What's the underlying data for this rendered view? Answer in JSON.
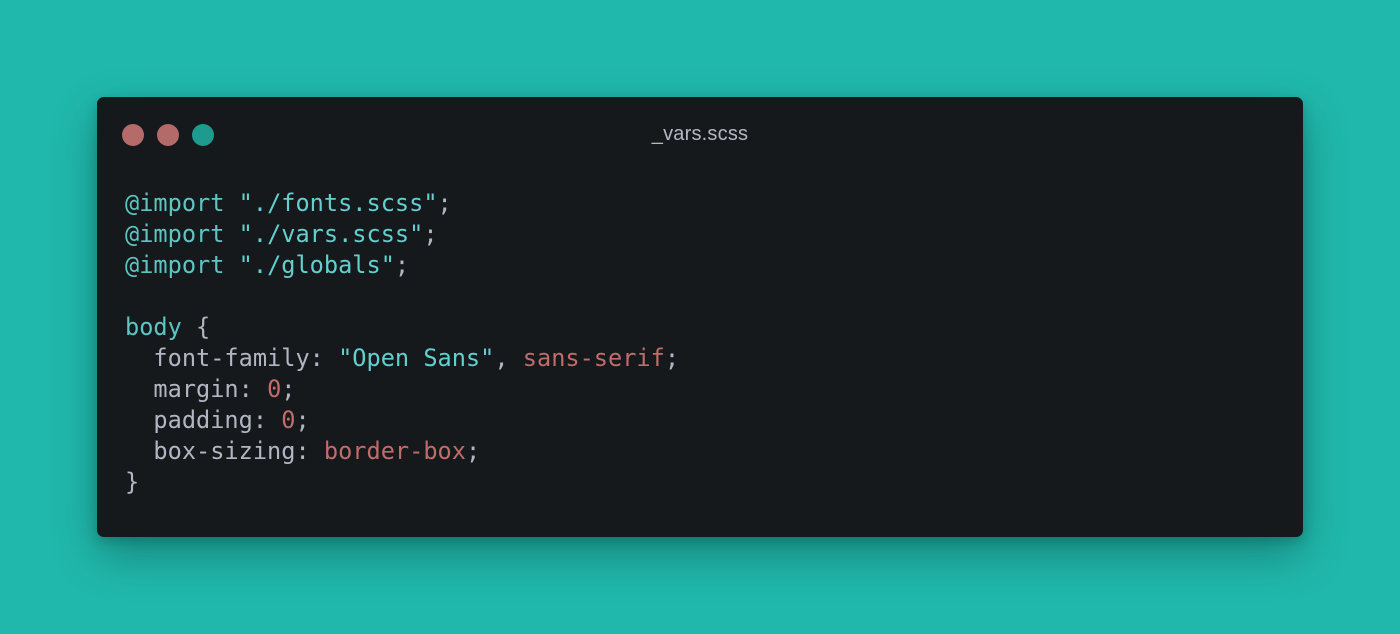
{
  "window": {
    "title": "_vars.scss",
    "controls": [
      {
        "name": "close",
        "color": "#b56b6a"
      },
      {
        "name": "minimize",
        "color": "#b36b6a"
      },
      {
        "name": "zoom",
        "color": "#1e9a8e"
      }
    ]
  },
  "colors": {
    "background": "#20b8ac",
    "editor": "#15191c",
    "at_rule": "#5ec5c3",
    "string": "#62d0ce",
    "keyword": "#c26b6b",
    "text": "#b2b6c3"
  },
  "code": {
    "lines": [
      [
        {
          "t": "@import",
          "k": "at"
        },
        {
          "t": " ",
          "k": "punc"
        },
        {
          "t": "\"./fonts.scss\"",
          "k": "str"
        },
        {
          "t": ";",
          "k": "punc"
        }
      ],
      [
        {
          "t": "@import",
          "k": "at"
        },
        {
          "t": " ",
          "k": "punc"
        },
        {
          "t": "\"./vars.scss\"",
          "k": "str"
        },
        {
          "t": ";",
          "k": "punc"
        }
      ],
      [
        {
          "t": "@import",
          "k": "at"
        },
        {
          "t": " ",
          "k": "punc"
        },
        {
          "t": "\"./globals\"",
          "k": "str"
        },
        {
          "t": ";",
          "k": "punc"
        }
      ],
      [],
      [
        {
          "t": "body",
          "k": "sel"
        },
        {
          "t": " {",
          "k": "punc"
        }
      ],
      [
        {
          "t": "  font-family",
          "k": "prop"
        },
        {
          "t": ": ",
          "k": "punc"
        },
        {
          "t": "\"Open Sans\"",
          "k": "str"
        },
        {
          "t": ", ",
          "k": "punc"
        },
        {
          "t": "sans-serif",
          "k": "kw"
        },
        {
          "t": ";",
          "k": "punc"
        }
      ],
      [
        {
          "t": "  margin",
          "k": "prop"
        },
        {
          "t": ": ",
          "k": "punc"
        },
        {
          "t": "0",
          "k": "num"
        },
        {
          "t": ";",
          "k": "punc"
        }
      ],
      [
        {
          "t": "  padding",
          "k": "prop"
        },
        {
          "t": ": ",
          "k": "punc"
        },
        {
          "t": "0",
          "k": "num"
        },
        {
          "t": ";",
          "k": "punc"
        }
      ],
      [
        {
          "t": "  box-sizing",
          "k": "prop"
        },
        {
          "t": ": ",
          "k": "punc"
        },
        {
          "t": "border-box",
          "k": "kw"
        },
        {
          "t": ";",
          "k": "punc"
        }
      ],
      [
        {
          "t": "}",
          "k": "punc"
        }
      ]
    ]
  }
}
